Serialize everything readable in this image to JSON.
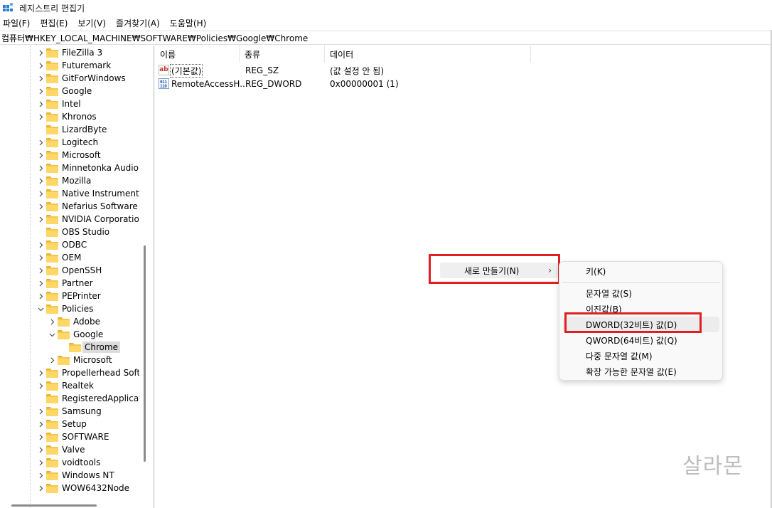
{
  "window": {
    "title": "레지스트리 편집기"
  },
  "menu": [
    "파일(F)",
    "편집(E)",
    "보기(V)",
    "즐겨찾기(A)",
    "도움말(H)"
  ],
  "address": "컴퓨터₩HKEY_LOCAL_MACHINE₩SOFTWARE₩Policies₩Google₩Chrome",
  "tree": [
    {
      "label": "FileZilla 3",
      "expander": "collapsed",
      "depth": 0
    },
    {
      "label": "Futuremark",
      "expander": "collapsed",
      "depth": 0
    },
    {
      "label": "GitForWindows",
      "expander": "collapsed",
      "depth": 0
    },
    {
      "label": "Google",
      "expander": "collapsed",
      "depth": 0
    },
    {
      "label": "Intel",
      "expander": "collapsed",
      "depth": 0
    },
    {
      "label": "Khronos",
      "expander": "collapsed",
      "depth": 0
    },
    {
      "label": "LizardByte",
      "expander": "none",
      "depth": 0
    },
    {
      "label": "Logitech",
      "expander": "collapsed",
      "depth": 0
    },
    {
      "label": "Microsoft",
      "expander": "collapsed",
      "depth": 0
    },
    {
      "label": "Minnetonka Audio S",
      "expander": "collapsed",
      "depth": 0
    },
    {
      "label": "Mozilla",
      "expander": "collapsed",
      "depth": 0
    },
    {
      "label": "Native Instruments",
      "expander": "collapsed",
      "depth": 0
    },
    {
      "label": "Nefarius Software S",
      "expander": "collapsed",
      "depth": 0
    },
    {
      "label": "NVIDIA Corporation",
      "expander": "collapsed",
      "depth": 0
    },
    {
      "label": "OBS Studio",
      "expander": "none",
      "depth": 0
    },
    {
      "label": "ODBC",
      "expander": "collapsed",
      "depth": 0
    },
    {
      "label": "OEM",
      "expander": "collapsed",
      "depth": 0
    },
    {
      "label": "OpenSSH",
      "expander": "collapsed",
      "depth": 0
    },
    {
      "label": "Partner",
      "expander": "collapsed",
      "depth": 0
    },
    {
      "label": "PEPrinter",
      "expander": "collapsed",
      "depth": 0
    },
    {
      "label": "Policies",
      "expander": "expanded",
      "depth": 0
    },
    {
      "label": "Adobe",
      "expander": "collapsed",
      "depth": 1
    },
    {
      "label": "Google",
      "expander": "expanded",
      "depth": 1
    },
    {
      "label": "Chrome",
      "expander": "none",
      "depth": 2,
      "selected": true
    },
    {
      "label": "Microsoft",
      "expander": "collapsed",
      "depth": 1
    },
    {
      "label": "Propellerhead Softw",
      "expander": "collapsed",
      "depth": 0
    },
    {
      "label": "Realtek",
      "expander": "collapsed",
      "depth": 0
    },
    {
      "label": "RegisteredApplicatic",
      "expander": "none",
      "depth": 0
    },
    {
      "label": "Samsung",
      "expander": "collapsed",
      "depth": 0
    },
    {
      "label": "Setup",
      "expander": "collapsed",
      "depth": 0
    },
    {
      "label": "SOFTWARE",
      "expander": "collapsed",
      "depth": 0
    },
    {
      "label": "Valve",
      "expander": "collapsed",
      "depth": 0
    },
    {
      "label": "voidtools",
      "expander": "collapsed",
      "depth": 0
    },
    {
      "label": "Windows NT",
      "expander": "collapsed",
      "depth": 0
    },
    {
      "label": "WOW6432Node",
      "expander": "collapsed",
      "depth": 0
    }
  ],
  "list": {
    "columns": [
      "이름",
      "종류",
      "데이터"
    ],
    "rows": [
      {
        "icon": "string-value-icon",
        "icon_text": "ab",
        "name": "(기본값)",
        "type": "REG_SZ",
        "data": "(값 설정 안 됨)"
      },
      {
        "icon": "binary-value-icon",
        "icon_text": "011\n110",
        "name": "RemoteAccessH...",
        "type": "REG_DWORD",
        "data": "0x00000001 (1)"
      }
    ]
  },
  "context_menu": {
    "new_label": "새로 만들기(N)",
    "arrow": "›",
    "submenu": [
      "키(K)",
      "문자열 값(S)",
      "이진값(B)",
      "DWORD(32비트) 값(D)",
      "QWORD(64비트) 값(Q)",
      "다중 문자열 값(M)",
      "확장 가능한 문자열 값(E)"
    ]
  },
  "watermark": "살라몬",
  "colors": {
    "highlight_border": "#e02020",
    "folder": "#ffd767",
    "selection": "#dcdcdc"
  }
}
